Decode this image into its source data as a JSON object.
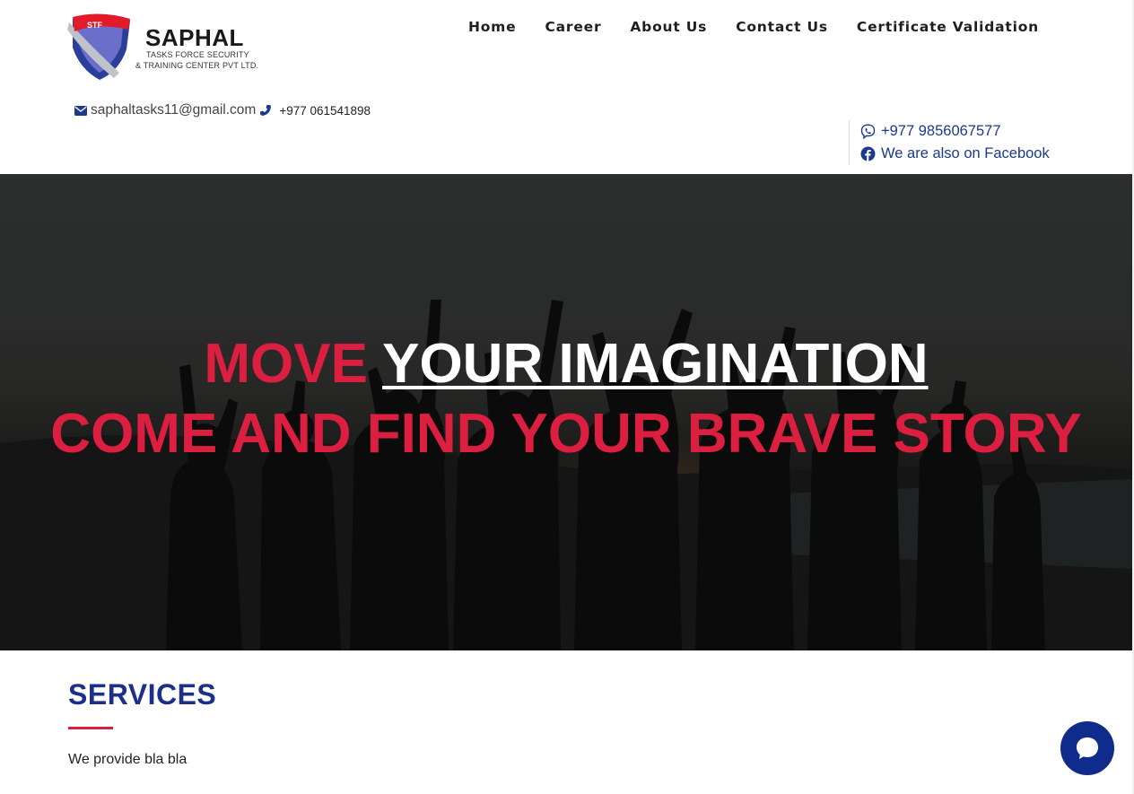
{
  "brand": {
    "initials": "STF",
    "name": "SAPHAL",
    "tagline_line1": "TASKS FORCE SECURITY",
    "tagline_line2": "& TRAINING CENTER PVT LTD."
  },
  "nav": {
    "items": [
      {
        "label": "Home"
      },
      {
        "label": "Career"
      },
      {
        "label": "About Us"
      },
      {
        "label": "Contact Us"
      },
      {
        "label": "Certificate Validation"
      }
    ]
  },
  "contact": {
    "email": "saphaltasks11@gmail.com",
    "phone": "+977 061541898",
    "viber": "+977 9856067577",
    "facebook": "We are also on Facebook"
  },
  "hero": {
    "line1_part1": "MOVE",
    "line1_part2": "YOUR IMAGINATION",
    "line2": "COME AND FIND YOUR BRAVE STORY"
  },
  "services": {
    "title": "SERVICES",
    "description": "We provide bla bla"
  },
  "icons": {
    "email": "envelope-icon",
    "phone": "phone-icon",
    "viber": "viber-icon",
    "facebook": "facebook-icon",
    "chat": "chat-bubble-icon"
  },
  "colors": {
    "accent_red": "#dc1f41",
    "brand_blue": "#1c2f8a",
    "chat_blue": "#0f2b8c"
  }
}
